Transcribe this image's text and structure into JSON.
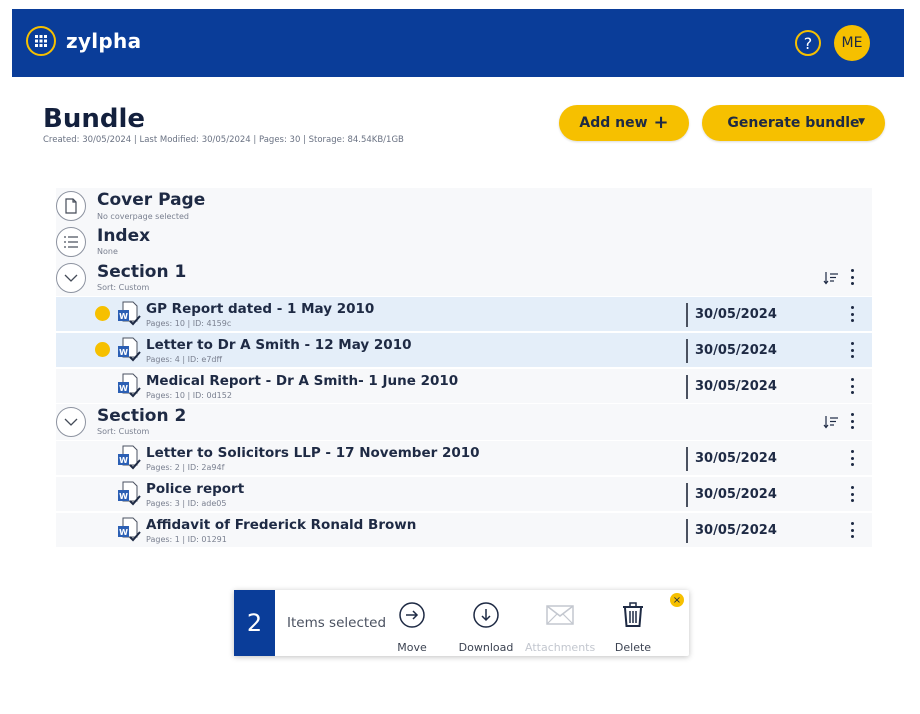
{
  "header": {
    "brand": "zylpha",
    "help_label": "?",
    "user_initials": "ME",
    "accent_color": "#f6c000",
    "bar_color": "#0a3d99"
  },
  "page": {
    "title": "Bundle",
    "meta": "Created: 30/05/2024 | Last Modified: 30/05/2024 | Pages: 30 | Storage: 84.54KB/1GB"
  },
  "actions": {
    "add_new": "Add new",
    "add_new_icon": "+",
    "generate": "Generate bundle"
  },
  "fixed_items": [
    {
      "title": "Cover Page",
      "sub": "No coverpage selected",
      "icon": "document-icon"
    },
    {
      "title": "Index",
      "sub": "None",
      "icon": "list-icon"
    }
  ],
  "sections": [
    {
      "title": "Section 1",
      "sort": "Sort: Custom",
      "docs": [
        {
          "title": "GP Report dated - 1 May 2010",
          "meta": "Pages: 10 | ID: 4159c",
          "date": "30/05/2024",
          "selected": true
        },
        {
          "title": "Letter to Dr A Smith - 12 May 2010",
          "meta": "Pages: 4 | ID: e7dff",
          "date": "30/05/2024",
          "selected": true
        },
        {
          "title": "Medical Report - Dr A Smith- 1 June 2010",
          "meta": "Pages: 10 | ID: 0d152",
          "date": "30/05/2024",
          "selected": false
        }
      ]
    },
    {
      "title": "Section 2",
      "sort": "Sort: Custom",
      "docs": [
        {
          "title": "Letter to Solicitors LLP - 17 November 2010",
          "meta": "Pages: 2 | ID: 2a94f",
          "date": "30/05/2024",
          "selected": false
        },
        {
          "title": "Police report",
          "meta": "Pages: 3 | ID: ade05",
          "date": "30/05/2024",
          "selected": false
        },
        {
          "title": "Affidavit of Frederick Ronald Brown",
          "meta": "Pages: 1 | ID: 01291",
          "date": "30/05/2024",
          "selected": false
        }
      ]
    }
  ],
  "selection_bar": {
    "count": "2",
    "label": "Items selected",
    "move": "Move",
    "download": "Download",
    "attachments": "Attachments",
    "delete": "Delete",
    "close": "×"
  }
}
